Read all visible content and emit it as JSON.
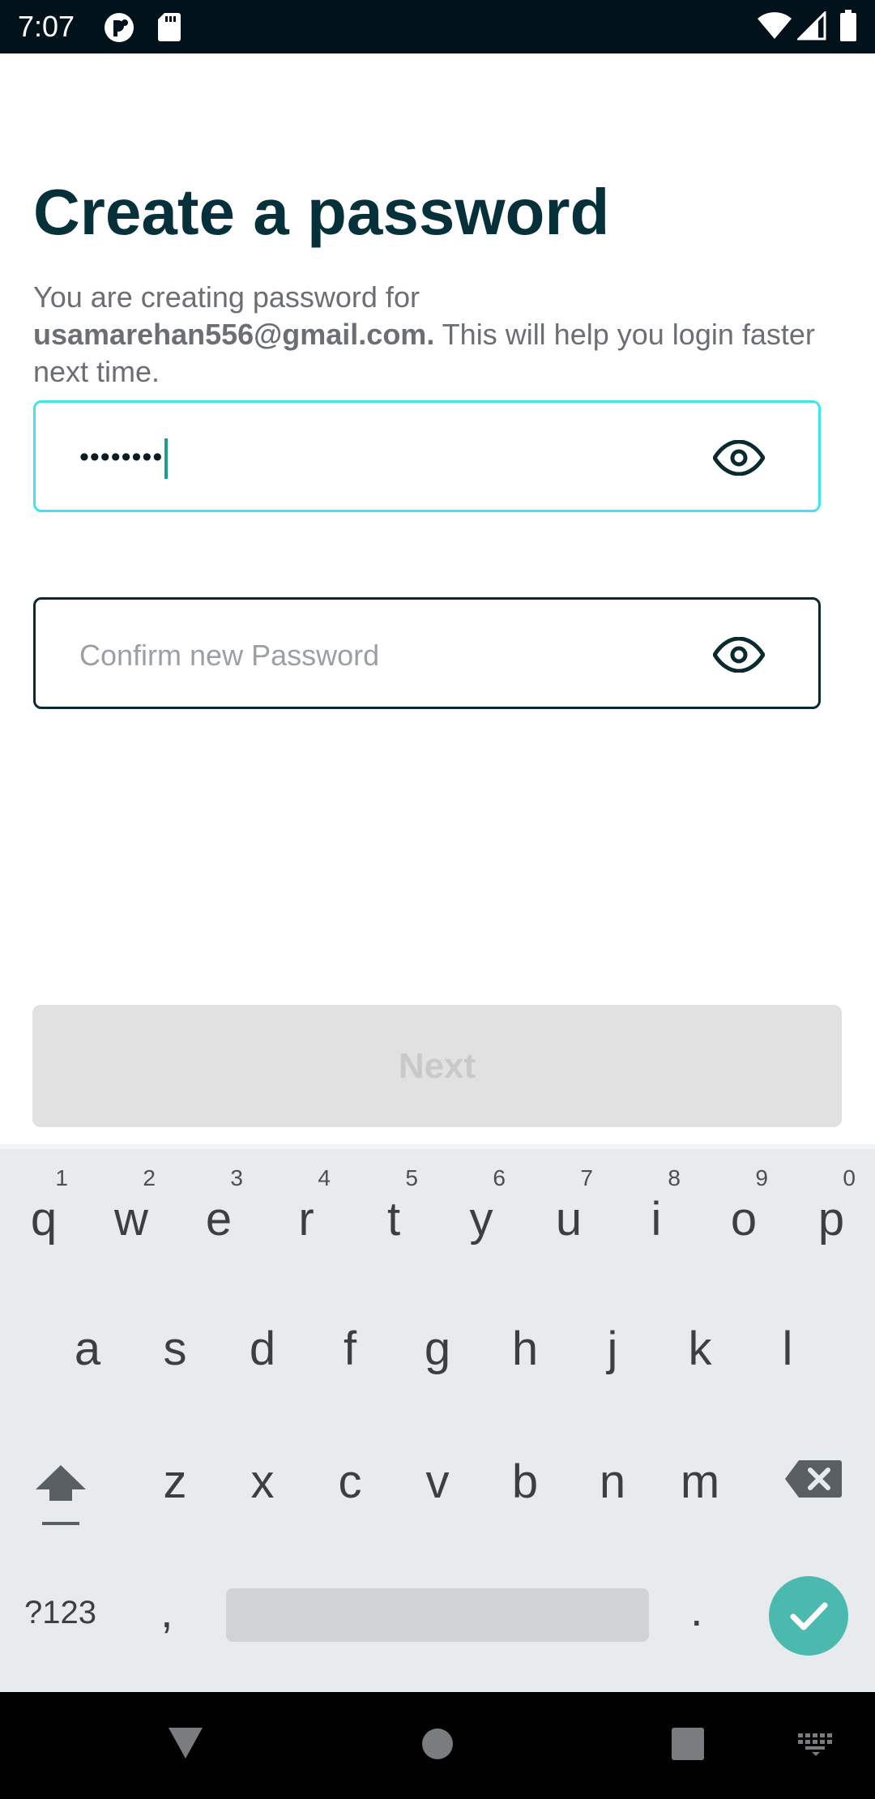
{
  "status_bar": {
    "time": "7:07",
    "icons": [
      "app-notification-icon",
      "sd-card-icon",
      "wifi-icon",
      "cell-signal-icon",
      "battery-icon"
    ]
  },
  "page": {
    "title": "Create a password",
    "subtitle_prefix": "You are creating password for ",
    "email": "usamarehan556@gmail.com.",
    "subtitle_suffix": " This will help you login faster next time."
  },
  "password_field": {
    "value": "••••••••",
    "state": "focused",
    "toggle_icon": "eye-icon"
  },
  "confirm_field": {
    "value": "",
    "placeholder": "Confirm new Password",
    "toggle_icon": "eye-icon"
  },
  "next_button": {
    "label": "Next",
    "enabled": false
  },
  "keyboard": {
    "row1": [
      {
        "letter": "q",
        "hint": "1"
      },
      {
        "letter": "w",
        "hint": "2"
      },
      {
        "letter": "e",
        "hint": "3"
      },
      {
        "letter": "r",
        "hint": "4"
      },
      {
        "letter": "t",
        "hint": "5"
      },
      {
        "letter": "y",
        "hint": "6"
      },
      {
        "letter": "u",
        "hint": "7"
      },
      {
        "letter": "i",
        "hint": "8"
      },
      {
        "letter": "o",
        "hint": "9"
      },
      {
        "letter": "p",
        "hint": "0"
      }
    ],
    "row2": [
      "a",
      "s",
      "d",
      "f",
      "g",
      "h",
      "j",
      "k",
      "l"
    ],
    "row3": [
      "z",
      "x",
      "c",
      "v",
      "b",
      "n",
      "m"
    ],
    "symbols_label": "?123",
    "comma": ",",
    "period": ".",
    "shift_icon": "shift-icon",
    "delete_icon": "backspace-icon",
    "enter_icon": "checkmark-icon"
  },
  "nav_bar": {
    "buttons": [
      "back-icon",
      "home-icon",
      "recents-icon",
      "keyboard-switch-icon"
    ]
  },
  "colors": {
    "title": "#07313a",
    "focused_border": "#3ee6ec",
    "default_border": "#0b2a30",
    "enter_key": "#4bb9ad",
    "disabled_button": "#e1e1e1"
  }
}
